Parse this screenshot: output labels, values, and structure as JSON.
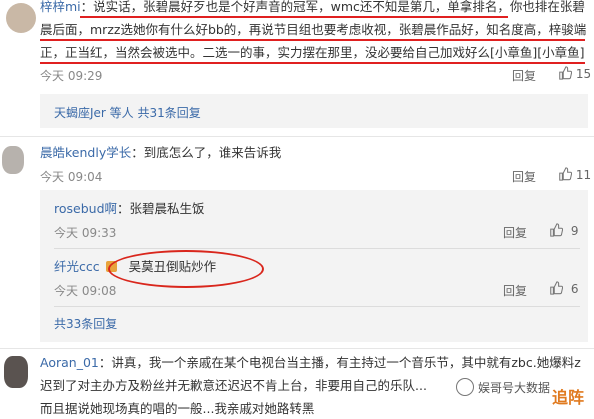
{
  "comment1": {
    "author": "梓梓mi",
    "lines": [
      "：说实话，张碧晨好歹也是个好声音的冠军，wmc还不知是第几，单拿排名，你也排在张碧",
      "晨后面，mrzz选她你有什么好bb的，再说节目组也要考虑收视，张碧晨作品好，知名度高，梓骏端",
      "正，正当红，当然会被选中。二选一的事，实力摆在那里，没必要给自己加戏好么[小章鱼][小章鱼]"
    ],
    "time": "今天 09:29",
    "reply_label": "回复",
    "like_count": "15"
  },
  "thread1_summary": {
    "names": "天蝎座Jer 等人",
    "count": "共31条回复"
  },
  "comment2": {
    "author": "晨皓kendly学长",
    "text": "：到底怎么了，谁来告诉我",
    "time": "今天 09:04",
    "reply_label": "回复",
    "like_count": "11"
  },
  "subreplies": [
    {
      "author": "rosebud啊",
      "text": "：张碧晨私生饭",
      "time": "今天 09:33",
      "reply_label": "回复",
      "like_count": "9"
    },
    {
      "author": "纤光ccc",
      "text": "吴莫丑倒贴炒作",
      "time": "今天 09:08",
      "reply_label": "回复",
      "like_count": "6"
    }
  ],
  "thread2_summary": {
    "count": "共33条回复"
  },
  "comment3": {
    "author": "Aoran_01",
    "lines": [
      "：讲真，我一个亲戚在某个电视台当主播，有主持过一个音乐节，其中就有zbc.她爆料z",
      "迟到了对主办方及粉丝并无歉意还迟迟不肯上台，非要用自己的乐队...",
      "而且据说她现场真的唱的一般...我亲戚对她路转黑"
    ]
  },
  "watermark": {
    "account": "娱哥号大数据",
    "badge": "追阵"
  },
  "colors": {
    "link_blue": "#3b6aa8",
    "annotation_red": "#d9261c",
    "reply_bg": "#f3f3f3"
  }
}
